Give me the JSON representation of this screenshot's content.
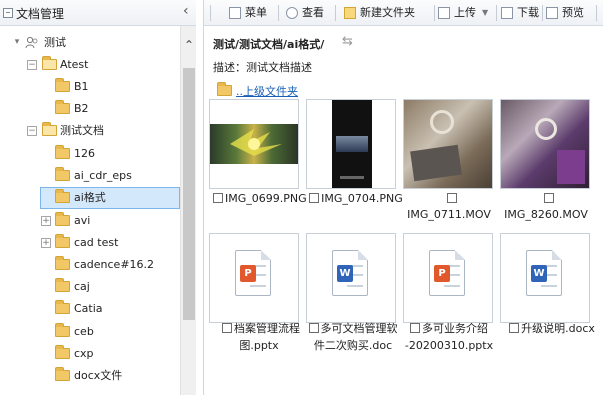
{
  "left_panel": {
    "title": "文档管理",
    "tree": [
      {
        "label": "测试",
        "level": 0,
        "expanded": true,
        "icon": "user-folder-icon"
      },
      {
        "label": "Atest",
        "level": 1,
        "expanded": true
      },
      {
        "label": "B1",
        "level": 2
      },
      {
        "label": "B2",
        "level": 2
      },
      {
        "label": "测试文档",
        "level": 1,
        "expanded": true
      },
      {
        "label": "126",
        "level": 2
      },
      {
        "label": "ai_cdr_eps",
        "level": 2
      },
      {
        "label": "ai格式",
        "level": 2,
        "selected": true
      },
      {
        "label": "avi",
        "level": 2,
        "expandable": true
      },
      {
        "label": "cad test",
        "level": 2,
        "expandable": true
      },
      {
        "label": "cadence#16.2",
        "level": 2
      },
      {
        "label": "caj",
        "level": 2
      },
      {
        "label": "Catia",
        "level": 2
      },
      {
        "label": "ceb",
        "level": 2
      },
      {
        "label": "cxp",
        "level": 2
      },
      {
        "label": "docx文件",
        "level": 2
      }
    ]
  },
  "toolbar": {
    "menu": "菜单",
    "view": "查看",
    "new_folder": "新建文件夹",
    "upload": "上传",
    "download": "下载",
    "preview": "预览"
  },
  "content": {
    "breadcrumb": "测试/测试文档/ai格式/",
    "description": "描述：测试文档描述",
    "parent_link": "..上级文件夹",
    "files": [
      {
        "name_lines": [
          "IMG_0699.PNG"
        ],
        "kind": "image"
      },
      {
        "name_lines": [
          "IMG_0704.PNG"
        ],
        "kind": "image"
      },
      {
        "name_lines": [
          "",
          "IMG_0711.MOV"
        ],
        "kind": "video"
      },
      {
        "name_lines": [
          "",
          "IMG_8260.MOV"
        ],
        "kind": "video"
      },
      {
        "name_lines": [
          "档案管理流程",
          "图.pptx"
        ],
        "kind": "pptx"
      },
      {
        "name_lines": [
          "多可文档管理软",
          "件二次购买.doc"
        ],
        "kind": "doc"
      },
      {
        "name_lines": [
          "多可业务介绍",
          "-20200310.pptx"
        ],
        "kind": "pptx"
      },
      {
        "name_lines": [
          "升级说明.docx"
        ],
        "kind": "doc"
      }
    ]
  },
  "colors": {
    "selection_bg": "#d4e8fb",
    "selection_border": "#7db6ea",
    "link": "#1a5fb4",
    "folder": "#f2c866",
    "ppt_badge": "#e2582d",
    "doc_badge": "#2f64b8"
  }
}
